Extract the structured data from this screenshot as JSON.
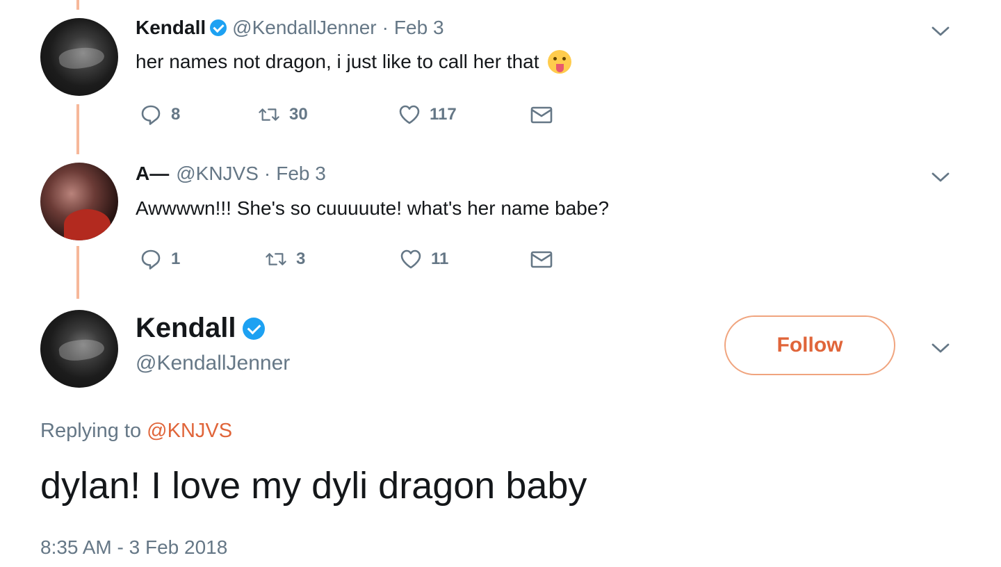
{
  "tweets": [
    {
      "name": "Kendall",
      "verified": true,
      "handle": "@KendallJenner",
      "sep": "·",
      "date": "Feb 3",
      "text": "her names not dragon, i just like to call her that",
      "emoji": "tongue-out-emoji",
      "replies": "8",
      "retweets": "30",
      "likes": "117"
    },
    {
      "name": "A—",
      "verified": false,
      "handle": "@KNJVS",
      "sep": "·",
      "date": "Feb 3",
      "text": "Awwwwn!!! She's so cuuuuute! what's her name babe?",
      "replies": "1",
      "retweets": "3",
      "likes": "11"
    }
  ],
  "main_tweet": {
    "name": "Kendall",
    "verified": true,
    "handle": "@KendallJenner",
    "follow_label": "Follow",
    "replying_prefix": "Replying to",
    "replying_mention": "@KNJVS",
    "text": "dylan! I love my dyli dragon baby",
    "timestamp": "8:35 AM - 3 Feb 2018"
  },
  "colors": {
    "accent": "#e0653a",
    "verified": "#1da1f2",
    "thread_line": "#f6b89a",
    "muted": "#657786",
    "text": "#14171a"
  }
}
